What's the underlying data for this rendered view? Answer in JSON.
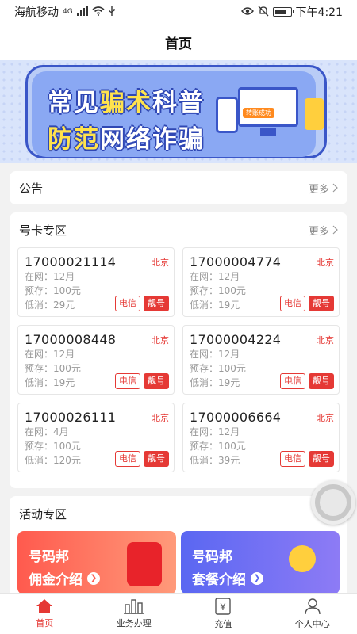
{
  "statusbar": {
    "carrier": "海航移动",
    "network": "4G",
    "time": "下午4:21"
  },
  "navbar": {
    "title": "首页"
  },
  "banner": {
    "line1_a": "常见",
    "line1_b": "骗术",
    "line1_c": "科普",
    "line2_a": "防范",
    "line2_b": "网络诈骗",
    "badge": "转账成功"
  },
  "notice": {
    "title": "公告",
    "more": "更多"
  },
  "numbers": {
    "title": "号卡专区",
    "more": "更多",
    "cards": [
      {
        "number": "17000021114",
        "city": "北京",
        "online": "在网：12月",
        "deposit": "预存：100元",
        "min": "低消：29元",
        "carrier_tag": "电信",
        "pretty_tag": "靓号"
      },
      {
        "number": "17000004774",
        "city": "北京",
        "online": "在网：12月",
        "deposit": "预存：100元",
        "min": "低消：19元",
        "carrier_tag": "电信",
        "pretty_tag": "靓号"
      },
      {
        "number": "17000008448",
        "city": "北京",
        "online": "在网：12月",
        "deposit": "预存：100元",
        "min": "低消：19元",
        "carrier_tag": "电信",
        "pretty_tag": "靓号"
      },
      {
        "number": "17000004224",
        "city": "北京",
        "online": "在网：12月",
        "deposit": "预存：100元",
        "min": "低消：19元",
        "carrier_tag": "电信",
        "pretty_tag": "靓号"
      },
      {
        "number": "17000026111",
        "city": "北京",
        "online": "在网：4月",
        "deposit": "预存：100元",
        "min": "低消：120元",
        "carrier_tag": "电信",
        "pretty_tag": "靓号"
      },
      {
        "number": "17000006664",
        "city": "北京",
        "online": "在网：12月",
        "deposit": "预存：100元",
        "min": "低消：39元",
        "carrier_tag": "电信",
        "pretty_tag": "靓号"
      }
    ]
  },
  "activity": {
    "title": "活动专区",
    "items": [
      {
        "line1": "号码邦",
        "line2": "佣金介绍"
      },
      {
        "line1": "号码邦",
        "line2": "套餐介绍"
      }
    ]
  },
  "tabbar": {
    "items": [
      {
        "label": "首页",
        "icon": "home-icon"
      },
      {
        "label": "业务办理",
        "icon": "chart-bars-icon"
      },
      {
        "label": "充值",
        "icon": "yuan-icon"
      },
      {
        "label": "个人中心",
        "icon": "user-icon"
      }
    ]
  },
  "colors": {
    "accent": "#e53935",
    "banner_blue": "#3a56c8"
  }
}
